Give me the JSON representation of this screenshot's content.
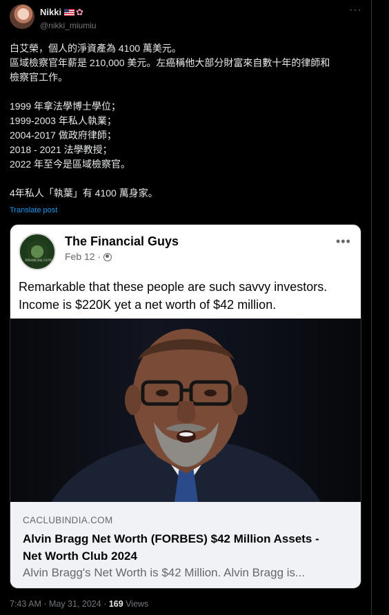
{
  "author": {
    "name": "Nikki",
    "handle": "@nikki_miumiu"
  },
  "icons": {
    "more": "more-horizontal-icon",
    "flag": "us-flag-icon",
    "sakura": "cherry-blossom-icon",
    "globe": "globe-icon"
  },
  "tweet": {
    "lines": [
      "白艾榮，個人的淨資產為 4100 萬美元。",
      "區域檢察官年薪是 210,000 美元。左癌稱他大部分財富來自數十年的律師和",
      "檢察官工作。",
      "",
      "1999 年拿法學博士學位；",
      "1999-2003 年私人執業；",
      "2004-2017 做政府律師；",
      "2018 - 2021 法學教授；",
      "2022 年至今是區域檢察官。",
      "",
      "4年私人「執葉」有 4100 萬身家。"
    ],
    "translate_label": "Translate post"
  },
  "embed": {
    "page_name": "The Financial Guys",
    "logo_text": "FINANCIAL GUYS",
    "date": "Feb 12 ·",
    "text_line1": "Remarkable that these people are such savvy investors.",
    "text_line2": "Income is $220K yet a net worth of $42 million.",
    "link_domain": "CACLUBINDIA.COM",
    "link_title_line1": "Alvin Bragg Net Worth (FORBES) $42 Million Assets -",
    "link_title_line2": "Net Worth Club 2024",
    "link_description": "Alvin Bragg's Net Worth is $42 Million. Alvin Bragg is..."
  },
  "meta": {
    "time_date": "7:43 AM · May 31, 2024 ·",
    "views_count": "169",
    "views_label": "Views"
  }
}
